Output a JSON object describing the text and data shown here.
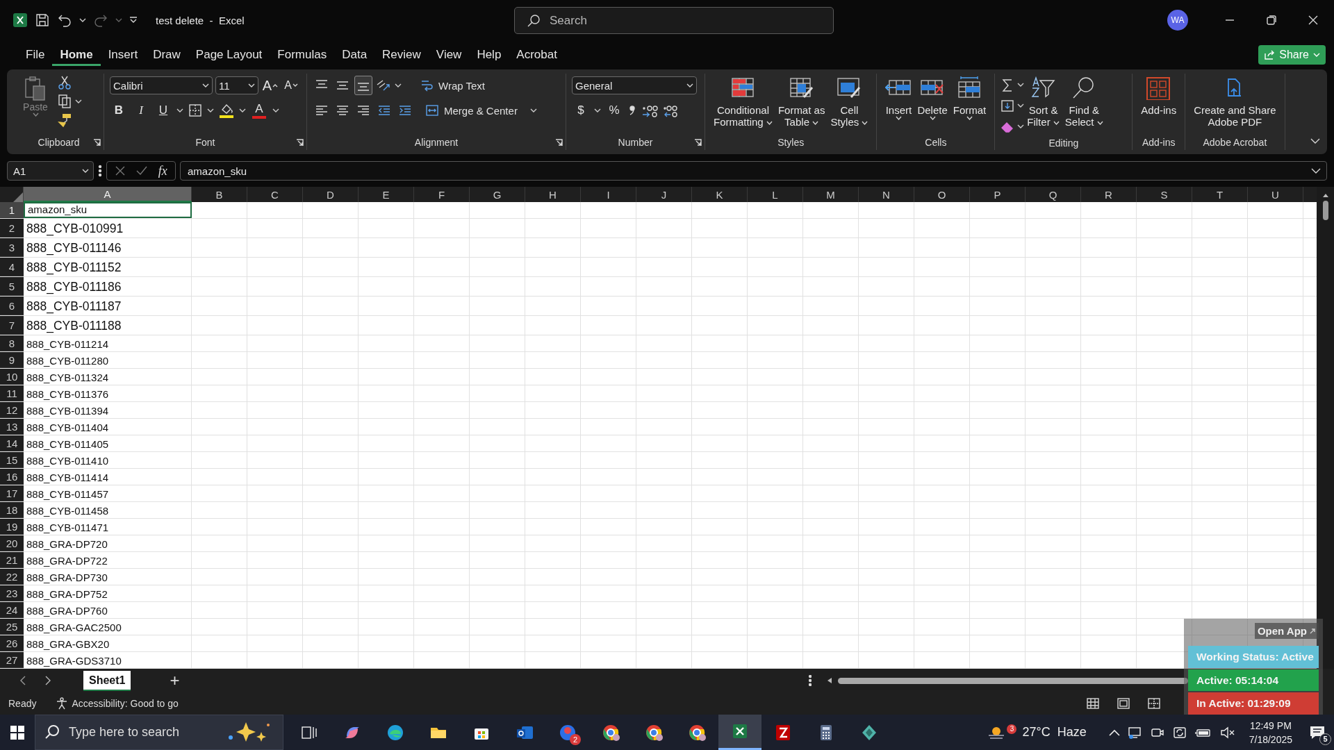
{
  "window": {
    "title": "test delete  -  Excel",
    "search_placeholder": "Search",
    "avatar": "WA"
  },
  "menu_tabs": [
    {
      "label": "File",
      "selected": false
    },
    {
      "label": "Home",
      "selected": true
    },
    {
      "label": "Insert",
      "selected": false
    },
    {
      "label": "Draw",
      "selected": false
    },
    {
      "label": "Page Layout",
      "selected": false
    },
    {
      "label": "Formulas",
      "selected": false
    },
    {
      "label": "Data",
      "selected": false
    },
    {
      "label": "Review",
      "selected": false
    },
    {
      "label": "View",
      "selected": false
    },
    {
      "label": "Help",
      "selected": false
    },
    {
      "label": "Acrobat",
      "selected": false
    }
  ],
  "share": "Share",
  "ribbon": {
    "groups": [
      {
        "kind": "clipboard",
        "label": "Clipboard",
        "launcher": true,
        "paste": "Paste",
        "paste_disabled": true
      },
      {
        "kind": "font",
        "label": "Font",
        "launcher": true,
        "font": "Calibri",
        "size": "11",
        "grow": "A",
        "shrink": "A",
        "bold": "B",
        "italic": "I",
        "underline": "U",
        "font_color": "A"
      },
      {
        "kind": "alignment",
        "label": "Alignment",
        "launcher": true,
        "vertical_align": [
          {
            "selected": false
          },
          {
            "selected": false
          },
          {
            "selected": true
          }
        ],
        "wrap": "Wrap Text",
        "merge": "Merge & Center"
      },
      {
        "kind": "number",
        "label": "Number",
        "launcher": true,
        "format": "General",
        "currency": "$",
        "percent": "%"
      },
      {
        "kind": "large",
        "label": "Styles",
        "buttons": [
          {
            "label": "Conditional\nFormatting",
            "caret": true
          },
          {
            "label": "Format as\nTable",
            "caret": true
          },
          {
            "label": "Cell\nStyles",
            "caret": true
          }
        ]
      },
      {
        "kind": "large",
        "label": "Cells",
        "buttons": [
          {
            "label": "Insert",
            "caret": true
          },
          {
            "label": "Delete",
            "caret": true
          },
          {
            "label": "Format",
            "caret": true
          }
        ]
      },
      {
        "kind": "editing",
        "label": "Editing",
        "buttons": [
          {
            "label": "Sort &\nFilter",
            "caret": true
          },
          {
            "label": "Find &\nSelect",
            "caret": true
          }
        ]
      },
      {
        "kind": "large",
        "label": "Add-ins",
        "buttons": [
          {
            "label": "Add-ins",
            "caret": false
          }
        ]
      },
      {
        "kind": "large",
        "label": "Adobe Acrobat",
        "buttons": [
          {
            "label": "Create and Share\nAdobe PDF",
            "caret": false
          }
        ]
      }
    ]
  },
  "formula_bar": {
    "name_box": "A1",
    "function_label": "fx",
    "value": "amazon_sku"
  },
  "columns": [
    {
      "label": "A",
      "selected": true
    },
    {
      "label": "B",
      "selected": false
    },
    {
      "label": "C",
      "selected": false
    },
    {
      "label": "D",
      "selected": false
    },
    {
      "label": "E",
      "selected": false
    },
    {
      "label": "F",
      "selected": false
    },
    {
      "label": "G",
      "selected": false
    },
    {
      "label": "H",
      "selected": false
    },
    {
      "label": "I",
      "selected": false
    },
    {
      "label": "J",
      "selected": false
    },
    {
      "label": "K",
      "selected": false
    },
    {
      "label": "L",
      "selected": false
    },
    {
      "label": "M",
      "selected": false
    },
    {
      "label": "N",
      "selected": false
    },
    {
      "label": "O",
      "selected": false
    },
    {
      "label": "P",
      "selected": false
    },
    {
      "label": "Q",
      "selected": false
    },
    {
      "label": "R",
      "selected": false
    },
    {
      "label": "S",
      "selected": false
    },
    {
      "label": "T",
      "selected": false
    },
    {
      "label": "U",
      "selected": false
    }
  ],
  "rows": [
    {
      "number": "1",
      "value": "amazon_sku",
      "kind": "normal",
      "selected": true
    },
    {
      "number": "2",
      "value": "888_CYB-010991",
      "kind": "large",
      "selected": false
    },
    {
      "number": "3",
      "value": "888_CYB-011146",
      "kind": "large",
      "selected": false
    },
    {
      "number": "4",
      "value": "888_CYB-011152",
      "kind": "large",
      "selected": false
    },
    {
      "number": "5",
      "value": "888_CYB-011186",
      "kind": "large",
      "selected": false
    },
    {
      "number": "6",
      "value": "888_CYB-011187",
      "kind": "large",
      "selected": false
    },
    {
      "number": "7",
      "value": "888_CYB-011188",
      "kind": "large",
      "selected": false
    },
    {
      "number": "8",
      "value": "888_CYB-011214",
      "kind": "normal",
      "selected": false
    },
    {
      "number": "9",
      "value": "888_CYB-011280",
      "kind": "normal",
      "selected": false
    },
    {
      "number": "10",
      "value": "888_CYB-011324",
      "kind": "normal",
      "selected": false
    },
    {
      "number": "11",
      "value": "888_CYB-011376",
      "kind": "normal",
      "selected": false
    },
    {
      "number": "12",
      "value": "888_CYB-011394",
      "kind": "normal",
      "selected": false
    },
    {
      "number": "13",
      "value": "888_CYB-011404",
      "kind": "normal",
      "selected": false
    },
    {
      "number": "14",
      "value": "888_CYB-011405",
      "kind": "normal",
      "selected": false
    },
    {
      "number": "15",
      "value": "888_CYB-011410",
      "kind": "normal",
      "selected": false
    },
    {
      "number": "16",
      "value": "888_CYB-011414",
      "kind": "normal",
      "selected": false
    },
    {
      "number": "17",
      "value": "888_CYB-011457",
      "kind": "normal",
      "selected": false
    },
    {
      "number": "18",
      "value": "888_CYB-011458",
      "kind": "normal",
      "selected": false
    },
    {
      "number": "19",
      "value": "888_CYB-011471",
      "kind": "normal",
      "selected": false
    },
    {
      "number": "20",
      "value": "888_GRA-DP720",
      "kind": "normal",
      "selected": false
    },
    {
      "number": "21",
      "value": "888_GRA-DP722",
      "kind": "normal",
      "selected": false
    },
    {
      "number": "22",
      "value": "888_GRA-DP730",
      "kind": "normal",
      "selected": false
    },
    {
      "number": "23",
      "value": "888_GRA-DP752",
      "kind": "normal",
      "selected": false
    },
    {
      "number": "24",
      "value": "888_GRA-DP760",
      "kind": "normal",
      "selected": false
    },
    {
      "number": "25",
      "value": "888_GRA-GAC2500",
      "kind": "normal",
      "selected": false
    },
    {
      "number": "26",
      "value": "888_GRA-GBX20",
      "kind": "normal",
      "selected": false
    },
    {
      "number": "27",
      "value": "888_GRA-GDS3710",
      "kind": "normal",
      "selected": false
    }
  ],
  "sheet_tabs": [
    {
      "label": "Sheet1",
      "selected": true
    }
  ],
  "add_sheet": "+",
  "status_bar": {
    "ready": "Ready",
    "accessibility": "Accessibility: Good to go"
  },
  "tracker": {
    "open_app": "Open App",
    "items": [
      {
        "label": "Working Status: Active",
        "color": "#62c0d6"
      },
      {
        "label": "Active: 05:14:04",
        "color": "#22a24c"
      },
      {
        "label": "In Active: 01:29:09",
        "color": "#cf3d34"
      }
    ]
  },
  "taskbar": {
    "search_placeholder": "Type here to search",
    "apps": [
      {
        "kind": "taskview",
        "active": false
      },
      {
        "kind": "copilot",
        "active": false
      },
      {
        "kind": "edge",
        "active": false
      },
      {
        "kind": "explorer",
        "active": false
      },
      {
        "kind": "store",
        "active": false
      },
      {
        "kind": "outlook",
        "active": false
      },
      {
        "kind": "zoho",
        "active": false,
        "badge": "2"
      },
      {
        "kind": "chrome",
        "active": false
      },
      {
        "kind": "chrome",
        "active": false
      },
      {
        "kind": "chrome",
        "active": false
      },
      {
        "kind": "excel",
        "active": true
      },
      {
        "kind": "filezilla",
        "active": false
      },
      {
        "kind": "calculator",
        "active": false
      },
      {
        "kind": "cube",
        "active": false
      }
    ],
    "weather_badge": "3",
    "weather": "27°C  Haze",
    "time": "12:49 PM",
    "date": "7/18/2025",
    "notifications": "5"
  }
}
